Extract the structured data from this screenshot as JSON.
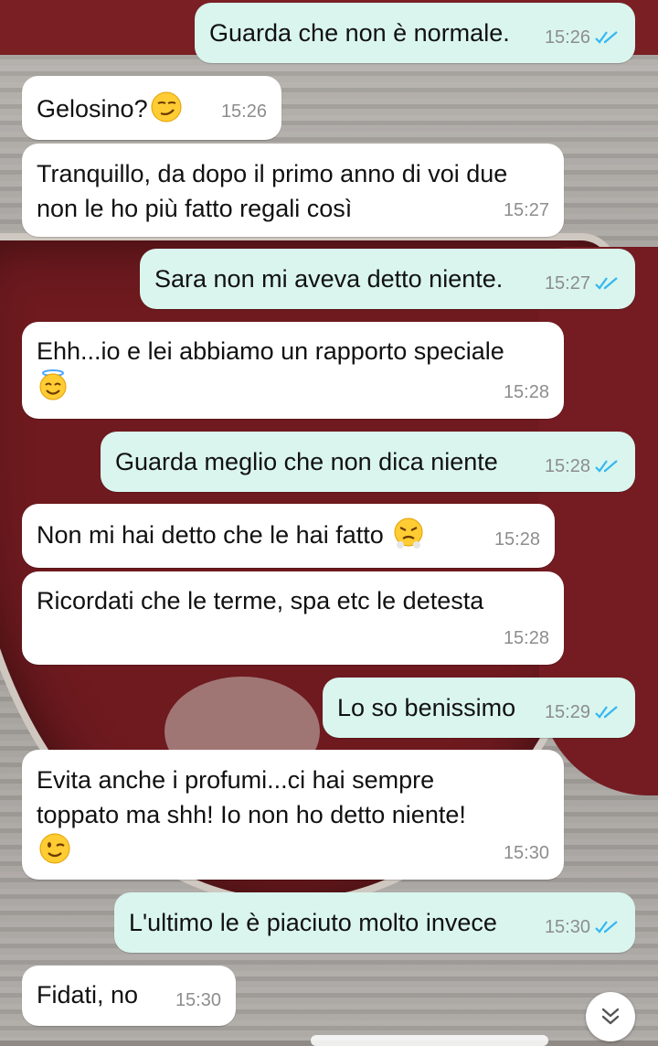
{
  "colors": {
    "incoming_bubble": "#ffffff",
    "outgoing_bubble": "#d9f5ee",
    "read_ticks": "#34b7f1",
    "timestamp": "#8d8d8d"
  },
  "messages": [
    {
      "direction": "outgoing",
      "text": "Guarda che non è normale.",
      "time": "15:26",
      "status": "read"
    },
    {
      "direction": "incoming",
      "text": "Gelosino?",
      "emoji": "smirking-face",
      "time": "15:26"
    },
    {
      "direction": "incoming",
      "text": "Tranquillo, da dopo il primo anno di voi due non le ho più fatto regali così",
      "time": "15:27"
    },
    {
      "direction": "outgoing",
      "text": "Sara non mi aveva detto niente.",
      "time": "15:27",
      "status": "read"
    },
    {
      "direction": "incoming",
      "text": "Ehh...io e lei abbiamo un rapporto speciale",
      "emoji": "smiling-face-with-halo",
      "time": "15:28"
    },
    {
      "direction": "outgoing",
      "text": "Guarda meglio che non dica niente",
      "time": "15:28",
      "status": "read"
    },
    {
      "direction": "incoming",
      "text": "Non mi hai detto che le hai fatto",
      "emoji": "face-with-steam-from-nose",
      "time": "15:28"
    },
    {
      "direction": "incoming",
      "text": "Ricordati che le terme, spa etc le detesta",
      "time": "15:28"
    },
    {
      "direction": "outgoing",
      "text": "Lo so benissimo",
      "time": "15:29",
      "status": "read"
    },
    {
      "direction": "incoming",
      "text": "Evita anche i profumi...ci hai sempre toppato ma shh! Io non ho detto niente!",
      "emoji": "winking-face",
      "time": "15:30"
    },
    {
      "direction": "outgoing",
      "text": "L'ultimo le è piaciuto molto invece",
      "time": "15:30",
      "status": "read"
    },
    {
      "direction": "incoming",
      "text": "Fidati, no",
      "time": "15:30"
    }
  ],
  "scroll_button": {
    "icon": "double-chevron-down-icon"
  }
}
